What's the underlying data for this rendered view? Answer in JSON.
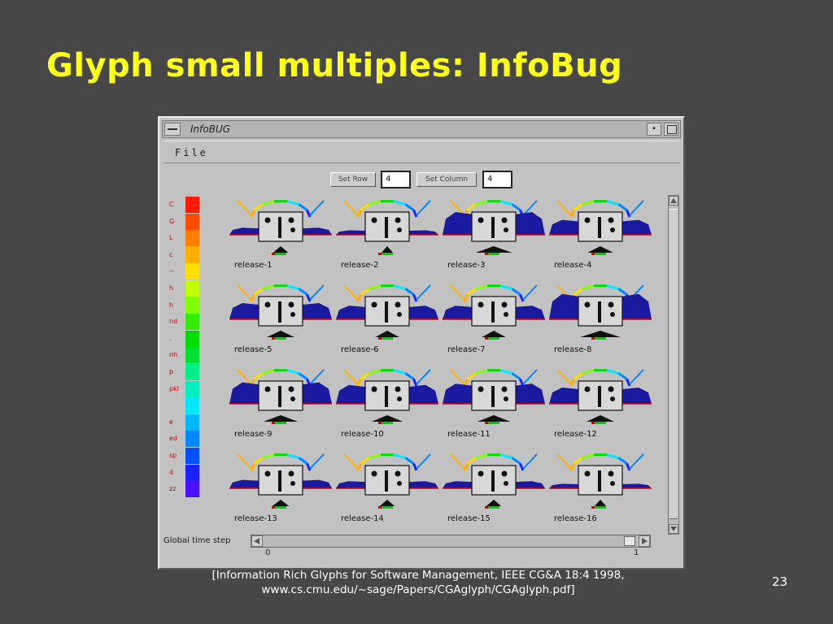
{
  "slide": {
    "title": "Glyph small multiples: InfoBug",
    "citation_line1": "[Information Rich Glyphs for Software Management, IEEE CG&A 18:4 1998,",
    "citation_line2": "www.cs.cmu.edu/~sage/Papers/CGAglyph/CGAglyph.pdf]",
    "page_number": "23"
  },
  "window": {
    "title": "InfoBUG",
    "menu_file": "File",
    "set_row_label": "Set Row",
    "row_value": "4",
    "set_column_label": "Set Column",
    "column_value": "4",
    "slider_label": "Global time step",
    "slider_min": "0",
    "slider_max": "1"
  },
  "legend": [
    {
      "label": "C",
      "color": "#ff1a00"
    },
    {
      "label": "G",
      "color": "#ff4a00"
    },
    {
      "label": "L",
      "color": "#ff8000"
    },
    {
      "label": "c",
      "color": "#ffb000"
    },
    {
      "label": "--",
      "color": "#ffe000"
    },
    {
      "label": "h",
      "color": "#c0ff00"
    },
    {
      "label": "h",
      "color": "#80ff00"
    },
    {
      "label": "nd",
      "color": "#33ee00"
    },
    {
      "label": ".",
      "color": "#00dd00"
    },
    {
      "label": "nh",
      "color": "#00e030"
    },
    {
      "label": "p",
      "color": "#00ee88"
    },
    {
      "label": "pkl",
      "color": "#00f0c0"
    },
    {
      "label": "",
      "color": "#00e8ff"
    },
    {
      "label": "e",
      "color": "#00b8ff"
    },
    {
      "label": "ed",
      "color": "#0088ff"
    },
    {
      "label": "sp",
      "color": "#0050ff"
    },
    {
      "label": "4",
      "color": "#1a20ff"
    },
    {
      "label": "zz",
      "color": "#4a10ff"
    }
  ],
  "glyphs": [
    {
      "label": "release-1",
      "area": 0.15
    },
    {
      "label": "release-2",
      "area": 0.05
    },
    {
      "label": "release-3",
      "area": 0.75
    },
    {
      "label": "release-4",
      "area": 0.45
    },
    {
      "label": "release-5",
      "area": 0.5
    },
    {
      "label": "release-6",
      "area": 0.4
    },
    {
      "label": "release-7",
      "area": 0.4
    },
    {
      "label": "release-8",
      "area": 0.85
    },
    {
      "label": "release-9",
      "area": 0.7
    },
    {
      "label": "release-10",
      "area": 0.6
    },
    {
      "label": "release-11",
      "area": 0.65
    },
    {
      "label": "release-12",
      "area": 0.5
    },
    {
      "label": "release-13",
      "area": 0.2
    },
    {
      "label": "release-14",
      "area": 0.15
    },
    {
      "label": "release-15",
      "area": 0.15
    },
    {
      "label": "release-16",
      "area": 0.05
    }
  ]
}
